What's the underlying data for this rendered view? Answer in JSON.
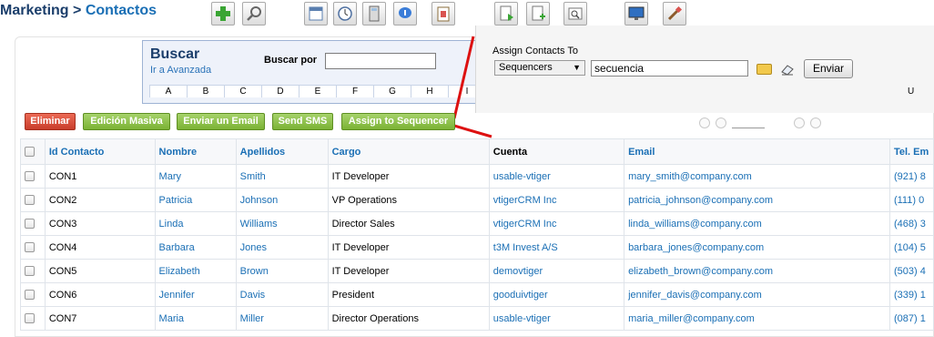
{
  "breadcrumb": {
    "module": "Marketing",
    "separator": ">",
    "page": "Contactos"
  },
  "toolbar": {
    "icons": [
      "add-icon",
      "search-icon",
      "calendar-icon",
      "clock-icon",
      "calculator-icon",
      "chat-icon",
      "import-icon",
      "export-icon",
      "add-document-icon",
      "find-duplicates-icon",
      "monitor-icon",
      "settings-icon"
    ]
  },
  "search": {
    "title": "Buscar",
    "advanced_link": "Ir a Avanzada",
    "search_by_label": "Buscar por",
    "search_value": "",
    "alphabet": [
      "A",
      "B",
      "C",
      "D",
      "E",
      "F",
      "G",
      "H",
      "I"
    ]
  },
  "popup": {
    "title": "Assign Contacts To",
    "select_value": "Sequencers",
    "input_value": "secuencia",
    "send_label": "Enviar",
    "alphabet_tail": "U",
    "colors": {
      "line": "#dd1111"
    }
  },
  "actions": {
    "delete": "Eliminar",
    "mass_edit": "Edición Masiva",
    "send_email": "Enviar un Email",
    "send_sms": "Send SMS",
    "assign_sequencer": "Assign to Sequencer"
  },
  "table": {
    "columns": [
      "Id Contacto",
      "Nombre",
      "Apellidos",
      "Cargo",
      "Cuenta",
      "Email",
      "Tel. Em"
    ],
    "rows": [
      [
        "CON1",
        "Mary",
        "Smith",
        "IT Developer",
        "usable-vtiger",
        "mary_smith@company.com",
        "(921) 8"
      ],
      [
        "CON2",
        "Patricia",
        "Johnson",
        "VP Operations",
        "vtigerCRM Inc",
        "patricia_johnson@company.com",
        "(111) 0"
      ],
      [
        "CON3",
        "Linda",
        "Williams",
        "Director Sales",
        "vtigerCRM Inc",
        "linda_williams@company.com",
        "(468) 3"
      ],
      [
        "CON4",
        "Barbara",
        "Jones",
        "IT Developer",
        "t3M Invest A/S",
        "barbara_jones@company.com",
        "(104) 5"
      ],
      [
        "CON5",
        "Elizabeth",
        "Brown",
        "IT Developer",
        "demovtiger",
        "elizabeth_brown@company.com",
        "(503) 4"
      ],
      [
        "CON6",
        "Jennifer",
        "Davis",
        "President",
        "gooduivtiger",
        "jennifer_davis@company.com",
        "(339) 1"
      ],
      [
        "CON7",
        "Maria",
        "Miller",
        "Director Operations",
        "usable-vtiger",
        "maria_miller@company.com",
        "(087) 1"
      ]
    ]
  }
}
